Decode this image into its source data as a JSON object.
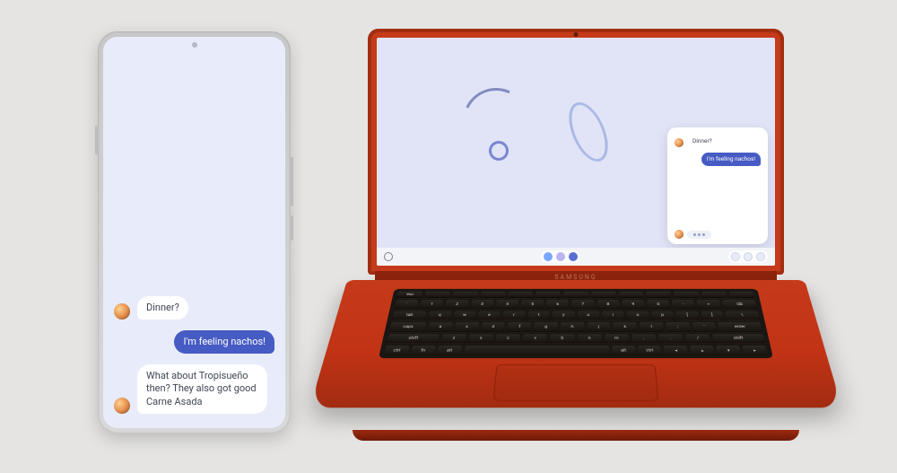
{
  "colors": {
    "background": "#e5e4e2",
    "phone_wallpaper": "#e8ecfa",
    "laptop_wallpaper": "#e0e4f6",
    "bubble_out": "#465bc3",
    "bubble_in": "#ffffff",
    "laptop_body": "#c53a1a"
  },
  "phone": {
    "messages": [
      {
        "direction": "in",
        "text": "Dinner?"
      },
      {
        "direction": "out",
        "text": "I'm feeling nachos!"
      },
      {
        "direction": "in",
        "text": "What about Tropisueño then? They also got good Carne Asada"
      }
    ]
  },
  "laptop": {
    "brand": "SAMSUNG",
    "chat_window": {
      "messages": [
        {
          "direction": "in",
          "text": "Dinner?"
        },
        {
          "direction": "out",
          "text": "I'm feeling nachos!"
        }
      ],
      "typing": true
    },
    "shelf": {
      "launcher_icon": "launcher-icon",
      "center_apps": [
        "app-blue",
        "app-lavender",
        "app-indigo"
      ],
      "status_icons": [
        "chat-icon",
        "pen-icon",
        "clock-icon"
      ]
    },
    "keyboard": {
      "row_fn": [
        "esc",
        "",
        "",
        "",
        "",
        "",
        "",
        "",
        "",
        "",
        "",
        "",
        ""
      ],
      "row1": [
        "`",
        "1",
        "2",
        "3",
        "4",
        "5",
        "6",
        "7",
        "8",
        "9",
        "0",
        "-",
        "=",
        "⌫"
      ],
      "row2": [
        "tab",
        "q",
        "w",
        "e",
        "r",
        "t",
        "y",
        "u",
        "i",
        "o",
        "p",
        "[",
        "]",
        "\\"
      ],
      "row3": [
        "caps",
        "a",
        "s",
        "d",
        "f",
        "g",
        "h",
        "j",
        "k",
        "l",
        ";",
        "'",
        "enter"
      ],
      "row4": [
        "shift",
        "z",
        "x",
        "c",
        "v",
        "b",
        "n",
        "m",
        ",",
        ".",
        "/",
        "shift"
      ],
      "row5": [
        "ctrl",
        "fn",
        "alt",
        "",
        "alt",
        "ctrl",
        "◂",
        "▴",
        "▾",
        "▸"
      ]
    }
  }
}
